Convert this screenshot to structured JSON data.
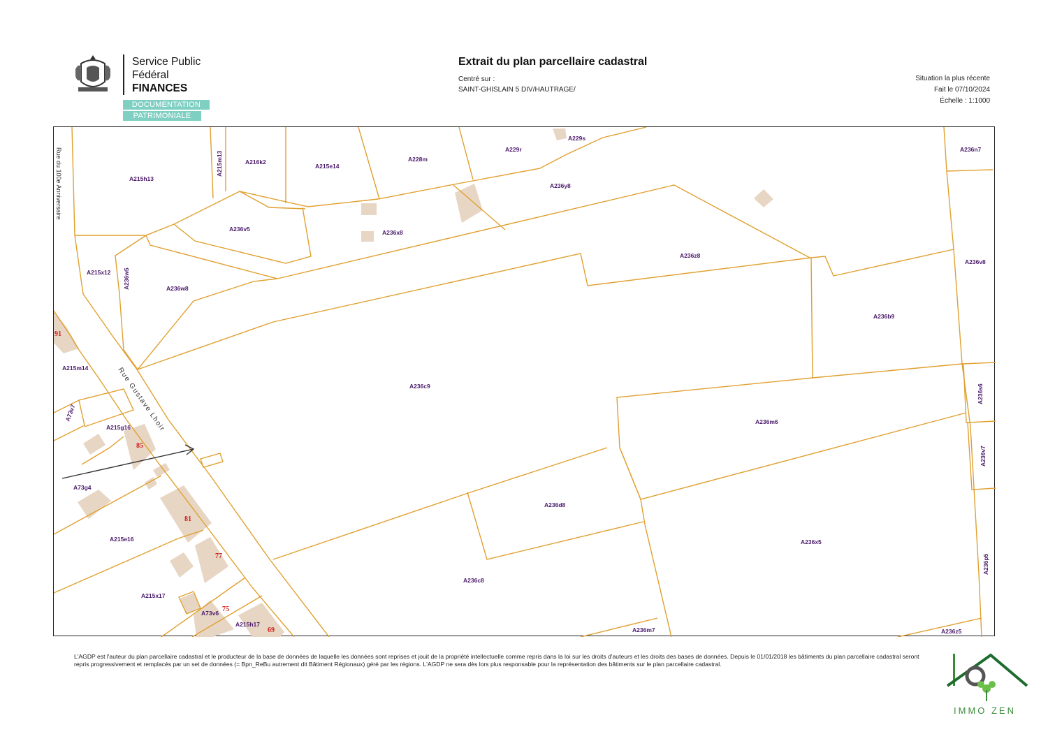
{
  "header": {
    "agency_line1": "Service Public",
    "agency_line2": "Fédéral",
    "agency_line3": "FINANCES",
    "badge_line1": "DOCUMENTATION",
    "badge_line2": "PATRIMONIALE",
    "title": "Extrait du plan parcellaire cadastral",
    "centre_label": "Centré sur :",
    "centre_value": "SAINT-GHISLAIN 5 DIV/HAUTRAGE/",
    "situation": "Situation la plus récente",
    "date": "Fait le 07/10/2024",
    "scale": "Échelle : 1:1000"
  },
  "map": {
    "colors": {
      "parcel_line": "#e0a030",
      "parcel_label": "#4b1a6b",
      "house_number": "#d02020",
      "building": "#e8d6c4",
      "street_text": "#333333"
    },
    "streets": [
      "Rue du 100e Anniversaire",
      "Rue Gustave Lhoir"
    ],
    "parcels": [
      "A215h13",
      "A215m13",
      "A216k2",
      "A215e14",
      "A228m",
      "A229r",
      "A229s",
      "A236n7",
      "A236y8",
      "A236v5",
      "A236x8",
      "A236z8",
      "A236v8",
      "A215x12",
      "A236w5",
      "A236w8",
      "A236b9",
      "A215m14",
      "A236c9",
      "A236s6",
      "A73v7",
      "A215g16",
      "A236m6",
      "A236v7",
      "A73g4",
      "A236d8",
      "A215e16",
      "A236x5",
      "A236c8",
      "A236p5",
      "A215x17",
      "A73v6",
      "A215h17",
      "A236m7",
      "A236z5"
    ],
    "house_numbers": [
      "91",
      "85",
      "81",
      "77",
      "75",
      "69"
    ]
  },
  "footer": {
    "disclaimer": "L'AGDP est l'auteur du plan parcellaire cadastral et le producteur de la base de données de laquelle les données sont reprises et jouit de la propriété intellectuelle comme repris dans la loi sur les droits d'auteurs et les droits des bases de données. Depuis le 01/01/2018 les bâtiments du plan parcellaire cadastral seront repris progressivement et remplacés par un set de données (= Bpn_ReBu autrement dit Bâtiment Régionaux) géré par les régions. L'AGDP ne sera dès lors plus responsable pour la représentation des bâtiments sur le plan parcellaire cadastral.",
    "logo_text": "IMMO ZEN"
  }
}
